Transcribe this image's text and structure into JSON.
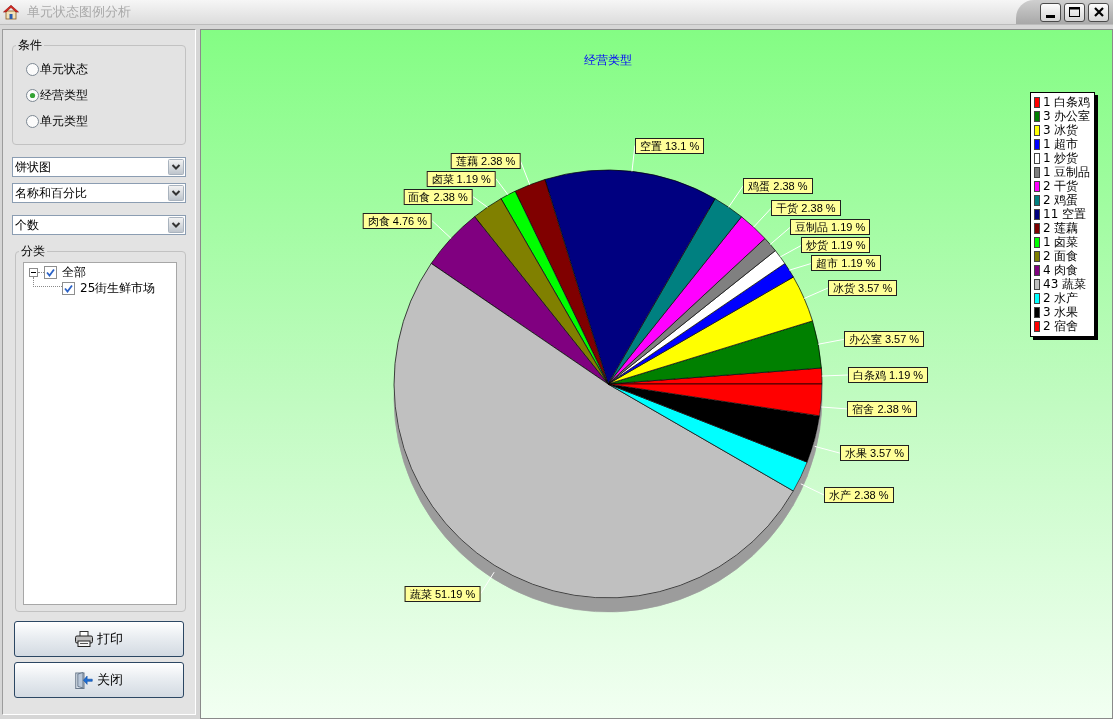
{
  "window": {
    "title": "单元状态图例分析"
  },
  "sidebar": {
    "conditions": {
      "title": "条件",
      "options": [
        {
          "label": "单元状态",
          "selected": false
        },
        {
          "label": "经营类型",
          "selected": true
        },
        {
          "label": "单元类型",
          "selected": false
        }
      ]
    },
    "selects": [
      {
        "value": "饼状图"
      },
      {
        "value": "名称和百分比"
      },
      {
        "value": "个数"
      }
    ],
    "categories": {
      "title": "分类",
      "tree": [
        {
          "label": "全部",
          "checked": true,
          "expanded": true,
          "children": [
            {
              "label": "25街生鲜市场",
              "checked": true
            }
          ]
        }
      ]
    },
    "buttons": [
      {
        "label": "打印",
        "kind": "print"
      },
      {
        "label": "关闭",
        "kind": "close"
      }
    ]
  },
  "chart": {
    "chart_data": {
      "type": "pie",
      "title": "经营类型",
      "categories": [
        "白条鸡",
        "办公室",
        "冰货",
        "超市",
        "炒货",
        "豆制品",
        "干货",
        "鸡蛋",
        "空置",
        "莲藕",
        "卤菜",
        "面食",
        "肉食",
        "蔬菜",
        "水产",
        "水果",
        "宿舍"
      ],
      "values": [
        1.19,
        3.57,
        3.57,
        1.19,
        1.19,
        1.19,
        2.38,
        2.38,
        13.1,
        2.38,
        1.19,
        2.38,
        4.76,
        51.19,
        2.38,
        3.57,
        2.38
      ],
      "colors": [
        "#ff0000",
        "#008000",
        "#ffff00",
        "#0000ff",
        "#ffffff",
        "#808080",
        "#ff00ff",
        "#008080",
        "#000080",
        "#800000",
        "#00ff00",
        "#808000",
        "#800080",
        "#c0c0c0",
        "#00ffff",
        "#000000",
        "#ff0000"
      ],
      "value_labels": [
        "1.19 %",
        "3.57 %",
        "3.57 %",
        "1.19 %",
        "1.19 %",
        "1.19 %",
        "2.38 %",
        "2.38 %",
        "13.1 %",
        "2.38 %",
        "1.19 %",
        "2.38 %",
        "4.76 %",
        "51.19 %",
        "2.38 %",
        "3.57 %",
        "2.38 %"
      ]
    },
    "legend": [
      {
        "label": "1 白条鸡",
        "color": "#ff0000"
      },
      {
        "label": "3 办公室",
        "color": "#008000"
      },
      {
        "label": "3 冰货",
        "color": "#ffff00"
      },
      {
        "label": "1 超市",
        "color": "#0000ff"
      },
      {
        "label": "1 炒货",
        "color": "#ffffff"
      },
      {
        "label": "1 豆制品",
        "color": "#808080"
      },
      {
        "label": "2 干货",
        "color": "#ff00ff"
      },
      {
        "label": "2 鸡蛋",
        "color": "#008080"
      },
      {
        "label": "11 空置",
        "color": "#000080"
      },
      {
        "label": "2 莲藕",
        "color": "#800000"
      },
      {
        "label": "1 卤菜",
        "color": "#00ff00"
      },
      {
        "label": "2 面食",
        "color": "#808000"
      },
      {
        "label": "4 肉食",
        "color": "#800080"
      },
      {
        "label": "43 蔬菜",
        "color": "#c0c0c0"
      },
      {
        "label": "2 水产",
        "color": "#00ffff"
      },
      {
        "label": "3 水果",
        "color": "#000000"
      },
      {
        "label": "2 宿舍",
        "color": "#ff0000"
      }
    ]
  }
}
